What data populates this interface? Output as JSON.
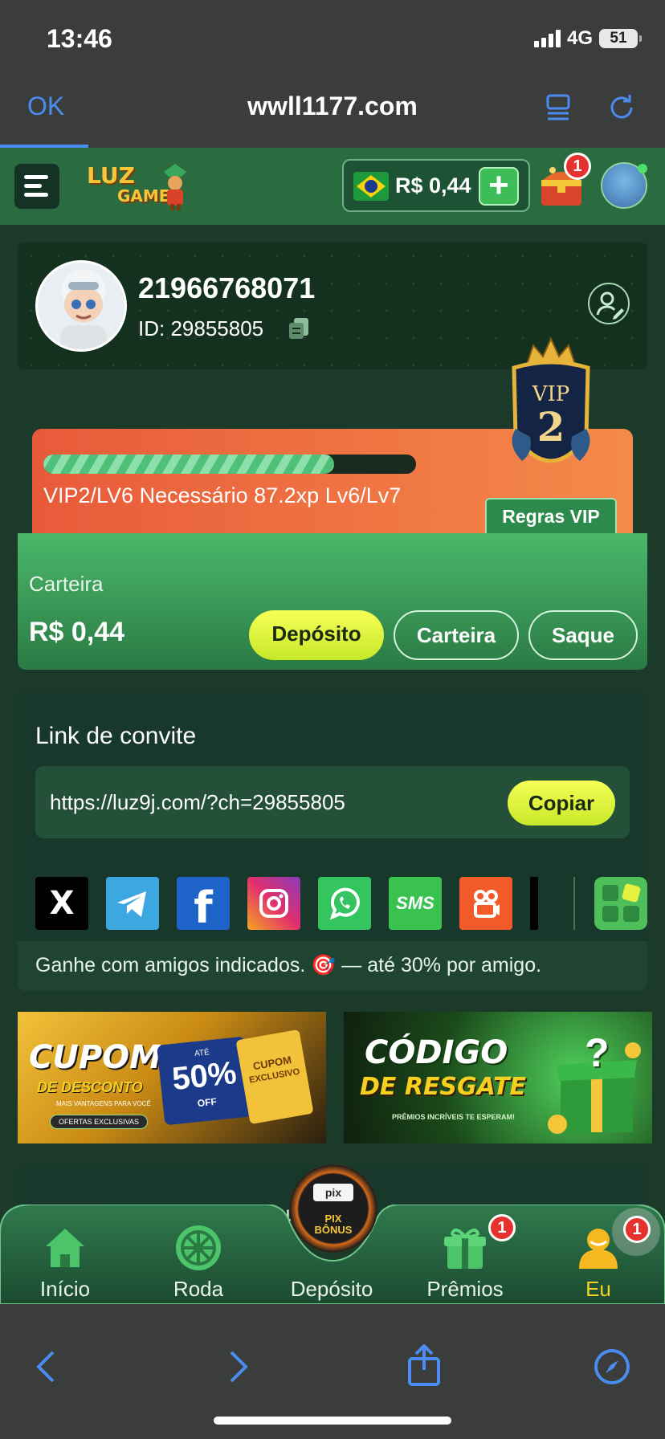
{
  "status_bar": {
    "time": "13:46",
    "network": "4G",
    "battery": "51"
  },
  "browser": {
    "ok_label": "OK",
    "url": "wwll1177.com"
  },
  "header": {
    "logo_line1": "LUZ",
    "logo_line2": "GAMES",
    "balance": "R$ 0,44",
    "add_label": "+",
    "chest_badge": "1"
  },
  "profile": {
    "username": "21966768071",
    "id_text": "ID: 29855805"
  },
  "vip": {
    "badge_title": "VIP",
    "badge_level": "2",
    "progress": 0.78,
    "status_text": "VIP2/LV6 Necessário 87.2xp Lv6/Lv7",
    "rules_label": "Regras VIP"
  },
  "wallet": {
    "label": "Carteira",
    "balance": "R$ 0,44",
    "deposit_label": "Depósito",
    "wallet_label": "Carteira",
    "withdraw_label": "Saque"
  },
  "invite": {
    "title": "Link de convite",
    "link": "https://luz9j.com/?ch=29855805",
    "copy_label": "Copiar",
    "social": [
      {
        "name": "x",
        "label": "X",
        "color": "#000000"
      },
      {
        "name": "telegram",
        "label": "",
        "color": "#3ca7e0"
      },
      {
        "name": "facebook",
        "label": "f",
        "color": "#1e63c8"
      },
      {
        "name": "instagram",
        "label": "",
        "color": "#e1306c"
      },
      {
        "name": "whatsapp",
        "label": "",
        "color": "#34c560"
      },
      {
        "name": "sms",
        "label": "SMS",
        "color": "#39c24e"
      },
      {
        "name": "kwai",
        "label": "",
        "color": "#f35a2a"
      }
    ],
    "footer_text": "Ganhe com amigos indicados. 🎯 — até 30% por amigo."
  },
  "banners": {
    "coupon": {
      "title_line1": "CUPOM",
      "title_line2": "DE DESCONTO",
      "subtitle": "MAIS VANTAGENS PARA VOCÊ",
      "chip": "OFERTAS EXCLUSIVAS",
      "discount_prefix": "ATÉ",
      "discount": "50%",
      "discount_suffix": "OFF",
      "ticket_line1": "CUPOM",
      "ticket_line2": "EXCLUSIVO"
    },
    "code": {
      "title_line1": "CÓDIGO",
      "title_line2": "DE RESGATE",
      "subtitle": "PRÊMIOS INCRÍVEIS TE ESPERAM!"
    }
  },
  "peek_text": "mu",
  "bottom_nav": {
    "items": [
      {
        "label": "Início",
        "active": false
      },
      {
        "label": "Roda",
        "active": false
      },
      {
        "label": "Depósito",
        "active": false
      },
      {
        "label": "Prêmios",
        "active": false,
        "badge": "1"
      },
      {
        "label": "Eu",
        "active": true,
        "badge": "1"
      }
    ],
    "pix_top": "pix",
    "pix_line1": "PIX",
    "pix_line2": "BÔNUS"
  },
  "colors": {
    "background": "#1c3a2a",
    "header_green": "#2a6b3f",
    "accent_yellow": "#f6ff56",
    "vip_orange": "#e85a3a",
    "active_nav": "#f5d020",
    "badge_red": "#e5322f",
    "ios_blue": "#4a8cf0"
  }
}
